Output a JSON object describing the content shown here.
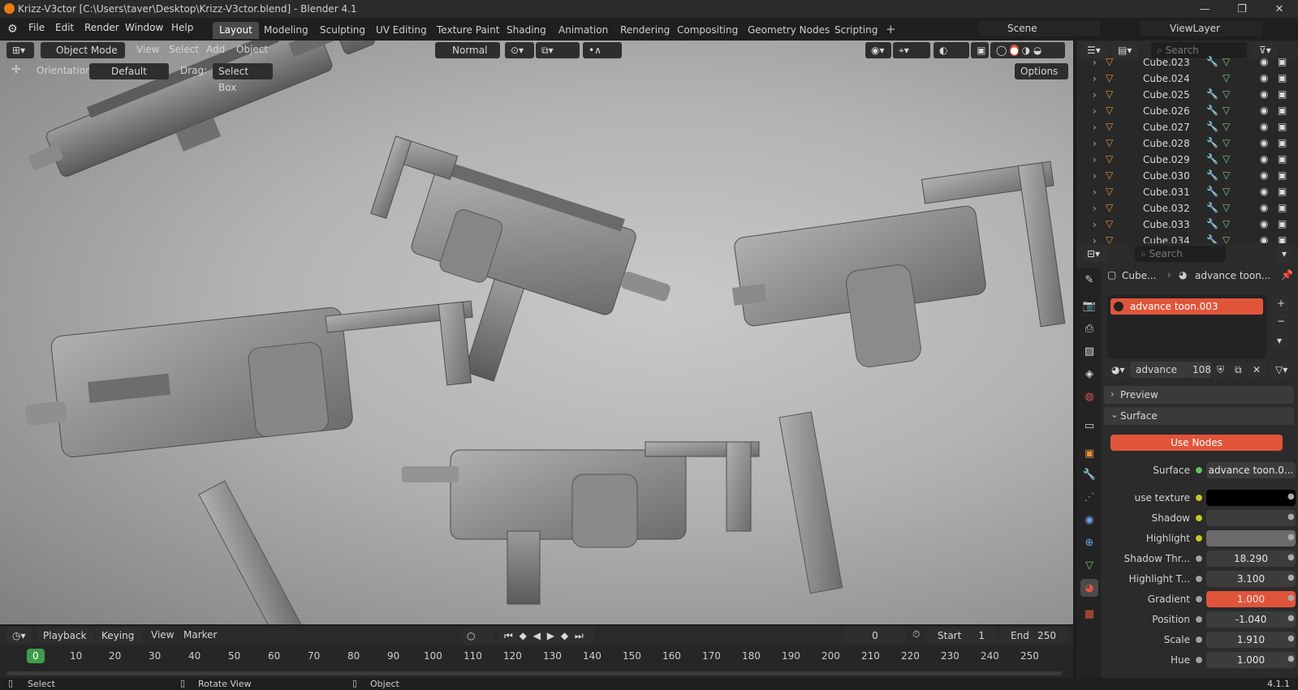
{
  "window": {
    "title": "Krizz-V3ctor [C:\\Users\\taver\\Desktop\\Krizz-V3ctor.blend] - Blender 4.1",
    "min": "—",
    "max": "❐",
    "close": "✕"
  },
  "menu": [
    "File",
    "Edit",
    "Render",
    "Window",
    "Help"
  ],
  "workspaces": [
    "Layout",
    "Modeling",
    "Sculpting",
    "UV Editing",
    "Texture Paint",
    "Shading",
    "Animation",
    "Rendering",
    "Compositing",
    "Geometry Nodes",
    "Scripting"
  ],
  "active_workspace": "Layout",
  "scene": "Scene",
  "view_layer": "ViewLayer",
  "viewport_header": {
    "mode": "Object Mode",
    "menus": [
      "View",
      "Select",
      "Add",
      "Object"
    ],
    "transform": "Normal",
    "orientation_label": "Orientation:",
    "orientation_value": "Default",
    "drag_label": "Drag:",
    "drag_value": "Select Box",
    "options": "Options"
  },
  "outliner": {
    "search_placeholder": "Search",
    "items": [
      "Cube.023",
      "Cube.024",
      "Cube.025",
      "Cube.026",
      "Cube.027",
      "Cube.028",
      "Cube.029",
      "Cube.030",
      "Cube.031",
      "Cube.032",
      "Cube.033",
      "Cube.034"
    ]
  },
  "properties": {
    "search_placeholder": "Search",
    "breadcrumb_object": "Cube...",
    "breadcrumb_material": "advance toon...",
    "slot": "advance toon.003",
    "material_name": "advance ...",
    "material_users": "108",
    "panels": {
      "preview": "Preview",
      "surface": "Surface"
    },
    "use_nodes": "Use Nodes",
    "surface_label": "Surface",
    "surface_value": "advance toon.0...",
    "inputs": [
      {
        "label": "use texture",
        "value": "",
        "socket": "#c7c729",
        "field": "#000000"
      },
      {
        "label": "Shadow",
        "value": "",
        "socket": "#c7c729",
        "field": "#3c3c3c"
      },
      {
        "label": "Highlight",
        "value": "",
        "socket": "#c7c729",
        "field": "#6a6a6a"
      },
      {
        "label": "Shadow Thr...",
        "value": "18.290",
        "socket": "#a1a1a1",
        "field": "#3c3c3c"
      },
      {
        "label": "Highlight T...",
        "value": "3.100",
        "socket": "#a1a1a1",
        "field": "#3c3c3c"
      },
      {
        "label": "Gradient",
        "value": "1.000",
        "socket": "#a1a1a1",
        "field": "#e0553a"
      },
      {
        "label": "Position",
        "value": "-1.040",
        "socket": "#a1a1a1",
        "field": "#3c3c3c"
      },
      {
        "label": "Scale",
        "value": "1.910",
        "socket": "#a1a1a1",
        "field": "#3c3c3c"
      },
      {
        "label": "Hue",
        "value": "1.000",
        "socket": "#a1a1a1",
        "field": "#3c3c3c"
      }
    ]
  },
  "timeline": {
    "menus": [
      "Playback",
      "Keying",
      "View",
      "Marker"
    ],
    "current_frame": "0",
    "start_label": "Start",
    "start": "1",
    "end_label": "End",
    "end": "250",
    "ruler": [
      "0",
      "10",
      "20",
      "30",
      "40",
      "50",
      "60",
      "70",
      "80",
      "90",
      "100",
      "110",
      "120",
      "130",
      "140",
      "150",
      "160",
      "170",
      "180",
      "190",
      "200",
      "210",
      "220",
      "230",
      "240",
      "250"
    ]
  },
  "status": {
    "select": "Select",
    "rotate": "Rotate View",
    "object": "Object",
    "version": "4.1.1"
  },
  "colors": {
    "accent": "#e0553a",
    "orange_icon": "#e8903a",
    "green_icon": "#7ec27e",
    "blue_icon": "#6aa6e0"
  }
}
